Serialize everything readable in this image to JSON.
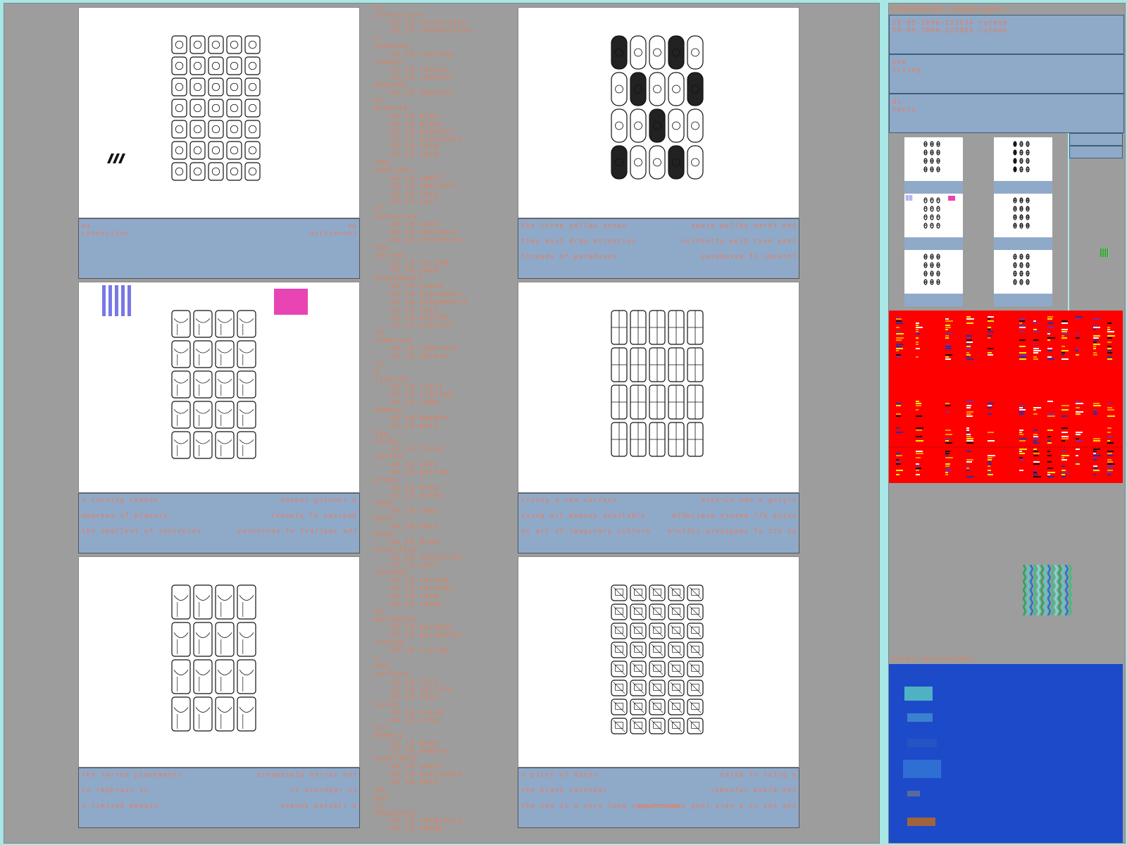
{
  "cards": [
    {
      "caption_lines": [
        {
          "left": "as\nconnection",
          "right": "as\nconnection"
        }
      ],
      "decor": "hatch-icon"
    },
    {
      "caption_lines": [
        {
          "left": "the three yellow areas",
          "right": "the three yellow areas"
        },
        {
          "left": "they must draw attention",
          "right": "they must draw attention"
        },
        {
          "left": "threads of paradoxes",
          "right": "threads of paradoxes"
        }
      ]
    },
    {
      "caption_lines": [
        {
          "left": "a cunning reason",
          "right": "a cunning reason"
        },
        {
          "left": "degrees of planets",
          "right": "degrees of planets"
        },
        {
          "left": "the smallest of sentences",
          "right": "the smallest of sentences"
        }
      ]
    },
    {
      "caption_lines": [
        {
          "left": "trying a new surface",
          "right": "trying a new surface"
        },
        {
          "left": "using all memory available",
          "right": "using all memory available"
        },
        {
          "left": "an act of imaginary culture",
          "right": "an act of imaginary culture"
        }
      ]
    },
    {
      "caption_lines": [
        {
          "left": "the sacred placements",
          "right": "the sacred placements"
        },
        {
          "left": "to rephrase it",
          "right": "to rephrase it"
        },
        {
          "left": "a limited domain",
          "right": "a limited domain"
        }
      ]
    },
    {
      "caption_lines": [
        {
          "left": "a pilot of dates",
          "right": "a pilot of dates"
        },
        {
          "left": "the blank calendar",
          "right": "the blank calendar"
        },
        {
          "left": "the sea is a very long spacestage",
          "right": "the sea is a very long spacestage"
        }
      ]
    }
  ],
  "index": [
    {
      "w": "as",
      "subs": []
    },
    {
      "w": "connection",
      "subs": [
        "a2_id connection",
        "a2_id connections"
      ]
    },
    {
      "w": "a",
      "subs": []
    },
    {
      "w": "cunning",
      "subs": [
        "a2_id cunning"
      ]
    },
    {
      "w": "reason",
      "subs": [
        "a2_id reason",
        "a2_id reasons"
      ]
    },
    {
      "w": "degrees",
      "subs": [
        "a2_id degrees"
      ]
    },
    {
      "w": "of",
      "subs": []
    },
    {
      "w": "planets",
      "subs": [
        "a2_id plan",
        "a2_id plans",
        "a2_id planets",
        "a2_id planetary",
        "a2_id land",
        "a2_id land"
      ]
    },
    {
      "w": "the",
      "subs": []
    },
    {
      "w": "smallest",
      "subs": [
        "a2_id small",
        "a2_id smallest",
        "a2_id less",
        "a2_id last"
      ]
    },
    {
      "w": "of",
      "subs": []
    },
    {
      "w": "sentences",
      "subs": [
        "a2_id sent",
        "a2_id sentence",
        "a2_id sentences"
      ]
    },
    {
      "w": "the",
      "subs": []
    },
    {
      "w": "sacred",
      "subs": [
        "a2_id sacred",
        "a2_id seed"
      ]
    },
    {
      "w": "placements",
      "subs": [
        "a2_id place",
        "a2_id placement",
        "a2_id placements",
        "a2_id lace",
        "a2_id placed",
        "a2_id placete"
      ]
    },
    {
      "w": "to",
      "subs": []
    },
    {
      "w": "rephrase",
      "subs": [
        "a2_id rephrase",
        "a2_id phrase"
      ]
    },
    {
      "w": "it",
      "subs": []
    },
    {
      "w": "a",
      "subs": []
    },
    {
      "w": "limited",
      "subs": [
        "a2_id limit",
        "a2_id limited",
        "a2_id lime"
      ]
    },
    {
      "w": "domain",
      "subs": [
        "a2_id domain",
        "a2_id main"
      ]
    },
    {
      "w": "the",
      "subs": []
    },
    {
      "w": "three",
      "subs": [
        "a2_id three"
      ]
    },
    {
      "w": "yellow",
      "subs": [
        "a2_id yell",
        "a2_id yellow"
      ]
    },
    {
      "w": "areas",
      "subs": [
        "a2_id area",
        "a2_id areas"
      ]
    },
    {
      "w": "they",
      "subs": [
        "a2_id they"
      ]
    },
    {
      "w": "must",
      "subs": [
        "a2_id must"
      ]
    },
    {
      "w": "draw",
      "subs": [
        "a2_id draw"
      ]
    },
    {
      "w": "attention",
      "subs": [
        "a2_id attention",
        "a2_id tent"
      ]
    },
    {
      "w": "threads",
      "subs": [
        "a2_id thread",
        "a2_id threads",
        "a2_id read",
        "a2_id reads"
      ]
    },
    {
      "w": "of",
      "subs": []
    },
    {
      "w": "paradoxes",
      "subs": [
        "a2_id paradox",
        "a2_id paradoxes"
      ]
    },
    {
      "w": "trying",
      "subs": [
        "a2_id trying"
      ]
    },
    {
      "w": "a",
      "subs": []
    },
    {
      "w": "new",
      "subs": []
    },
    {
      "w": "surface",
      "subs": [
        "a2_id surf",
        "a2_id surface",
        "a2_id face"
      ]
    },
    {
      "w": "using",
      "subs": [
        "a2_id using",
        "a2_id sing"
      ]
    },
    {
      "w": "all",
      "subs": []
    },
    {
      "w": "memory",
      "subs": [
        "a2_id memo",
        "a2_id memory"
      ]
    },
    {
      "w": "available",
      "subs": [
        "a2_id avail",
        "a2_id available",
        "a2_id able"
      ]
    },
    {
      "w": "an",
      "subs": []
    },
    {
      "w": "act",
      "subs": []
    },
    {
      "w": "of",
      "subs": []
    },
    {
      "w": "imaginary",
      "subs": [
        "a2_id imaginary",
        "a2_id image"
      ]
    }
  ],
  "sidebar": {
    "title": "STRUTSELEKT rudeansagett",
    "dates": "26-05-2006-222634 rutmah\n26-05-2006-222885 rutmah",
    "box2": "the\nliving",
    "box3": "as\ntexts",
    "footer_label": "total_strutselekt"
  },
  "colors": {
    "accent_text": "#f07a52",
    "caption_bg": "#8fa9c9",
    "panel_bg": "#9d9d9d",
    "page_bg": "#a9e6e6",
    "red_panel": "#ff0000",
    "blue_panel": "#1d4ac9",
    "magenta": "#e844b4",
    "purple": "#7878e6"
  }
}
